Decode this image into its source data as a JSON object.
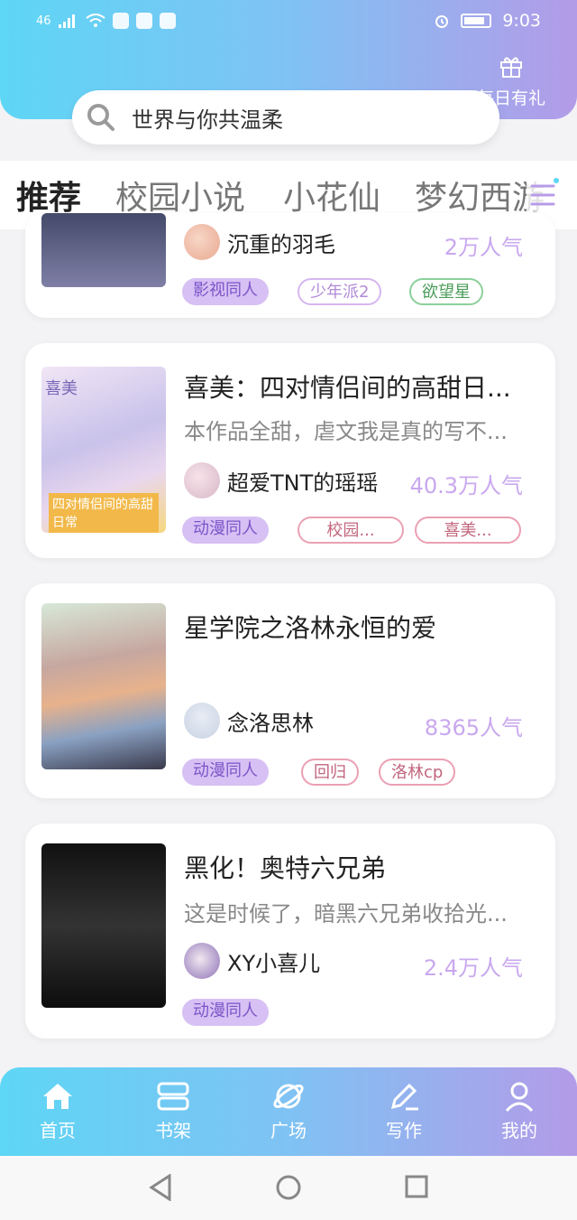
{
  "status": {
    "time": "9:03",
    "net": "46"
  },
  "header": {
    "gift_label": "每日有礼",
    "search": {
      "text": "世界与你共温柔"
    }
  },
  "tabs": [
    {
      "label": "推荐",
      "active": true
    },
    {
      "label": "校园小说"
    },
    {
      "label": "小花仙"
    },
    {
      "label": "梦幻西游"
    }
  ],
  "cards": [
    {
      "title": "",
      "desc": "",
      "author": "沉重的羽毛",
      "popularity": "2万人气",
      "tags": [
        {
          "label": "影视同人",
          "style": "solid"
        },
        {
          "label": "少年派2",
          "style": "purple"
        },
        {
          "label": "欲望星",
          "style": "green"
        }
      ]
    },
    {
      "title": "喜美：四对情侣间的高甜日...",
      "desc": "本作品全甜，虐文我是真的写不...",
      "author": "超爱TNT的瑶瑶",
      "popularity": "40.3万人气",
      "cover_text": "喜美",
      "cover_subtext": "四对情侣间的高甜日常",
      "tags": [
        {
          "label": "动漫同人",
          "style": "solid"
        },
        {
          "label": "校园...",
          "style": "pink"
        },
        {
          "label": "喜美...",
          "style": "pink"
        }
      ]
    },
    {
      "title": "星学院之洛林永恒的爱",
      "desc": "",
      "author": "念洛思林",
      "popularity": "8365人气",
      "tags": [
        {
          "label": "动漫同人",
          "style": "solid"
        },
        {
          "label": "回归",
          "style": "pink"
        },
        {
          "label": "洛林cp",
          "style": "pink"
        }
      ]
    },
    {
      "title": "黑化！奥特六兄弟",
      "desc": "这是时候了，暗黑六兄弟收拾光...",
      "author": "XY小喜儿",
      "popularity": "2.4万人气",
      "tags": [
        {
          "label": "动漫同人",
          "style": "solid"
        }
      ]
    }
  ],
  "bottom_nav": [
    {
      "label": "首页",
      "icon": "home-icon",
      "active": true
    },
    {
      "label": "书架",
      "icon": "bookshelf-icon"
    },
    {
      "label": "广场",
      "icon": "planet-icon"
    },
    {
      "label": "写作",
      "icon": "pen-icon"
    },
    {
      "label": "我的",
      "icon": "user-icon"
    }
  ],
  "colors": {
    "gradient_start": "#5ed6f5",
    "gradient_end": "#b39be8",
    "accent": "#c9a8ef"
  }
}
